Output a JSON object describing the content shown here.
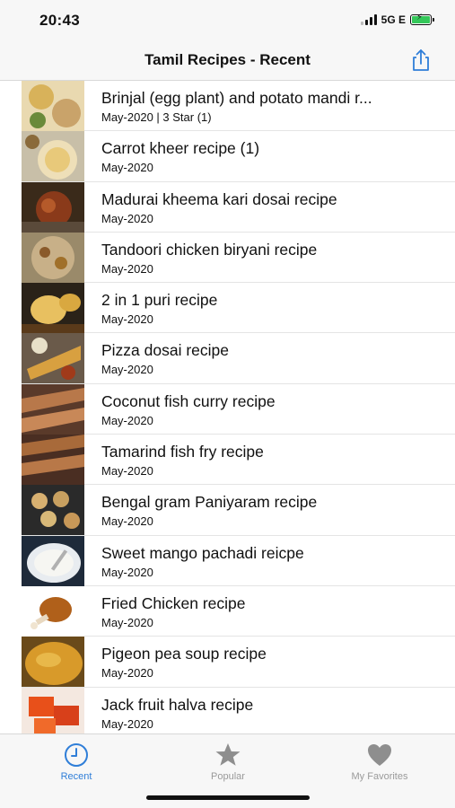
{
  "status": {
    "time": "20:43",
    "network": "5G E"
  },
  "nav": {
    "title": "Tamil Recipes - Recent"
  },
  "recipes": [
    {
      "title": "Brinjal (egg plant) and potato  mandi r...",
      "subtitle": "May-2020 | 3 Star (1)"
    },
    {
      "title": "Carrot kheer recipe (1)",
      "subtitle": "May-2020"
    },
    {
      "title": "Madurai kheema kari dosai recipe",
      "subtitle": "May-2020"
    },
    {
      "title": "Tandoori chicken biryani recipe",
      "subtitle": "May-2020"
    },
    {
      "title": "2 in 1 puri recipe",
      "subtitle": "May-2020"
    },
    {
      "title": "Pizza dosai recipe",
      "subtitle": "May-2020"
    },
    {
      "title": "Coconut fish curry recipe",
      "subtitle": "May-2020"
    },
    {
      "title": "Tamarind fish fry recipe",
      "subtitle": "May-2020"
    },
    {
      "title": "Bengal gram Paniyaram recipe",
      "subtitle": "May-2020"
    },
    {
      "title": "Sweet mango pachadi reicpe",
      "subtitle": "May-2020"
    },
    {
      "title": "Fried Chicken recipe",
      "subtitle": "May-2020"
    },
    {
      "title": "Pigeon pea soup recipe",
      "subtitle": "May-2020"
    },
    {
      "title": "Jack fruit halva recipe",
      "subtitle": "May-2020"
    }
  ],
  "tabs": [
    {
      "label": "Recent",
      "icon": "clock-icon",
      "active": true
    },
    {
      "label": "Popular",
      "icon": "star-icon",
      "active": false
    },
    {
      "label": "My Favorites",
      "icon": "heart-icon",
      "active": false
    }
  ],
  "colors": {
    "accent": "#2f7ed8",
    "inactive": "#9a9a9a",
    "bar_bg": "#f7f7f7"
  }
}
